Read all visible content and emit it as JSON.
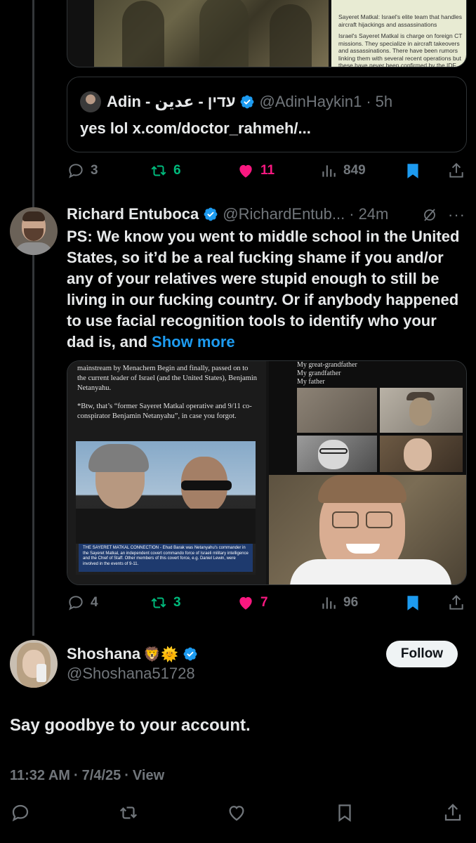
{
  "quoted_tweet_top": {
    "doc_heading": "Sayeret Matkal: Israel's elite team that handles aircraft hijackings and assassinations",
    "doc_body": "Israel's Sayeret Matkal is charge on foreign CT missions. They specialize in aircraft takeovers and assassinations. There have been rumors linking them with several recent operations but these have never been confirmed by the IDF."
  },
  "quote_card": {
    "name": "Adin - עדין - عدين",
    "handle": "@AdinHaykin1",
    "time": "5h",
    "sep": "·",
    "text": "yes lol x.com/doctor_rahmeh/..."
  },
  "actions_1": {
    "replies": "3",
    "reposts": "6",
    "likes": "11",
    "views": "849"
  },
  "reply_tweet": {
    "name": "Richard Entuboca",
    "handle": "@RichardEntub...",
    "sep": "·",
    "time": "24m",
    "text": "PS: We know you went to middle school in the United States, so it’d be a real fucking shame if you and/or any of your relatives were stupid enough to still be living in our fucking country. Or if anybody happened to use facial recognition tools to identify who your dad is, and",
    "show_more": "Show more",
    "img_left_text1": "mainstream by Menachem Begin and finally, passed on to the current leader of Israel (and the United States), Benjamin Netanyahu.",
    "img_left_text2": "*Btw, that’s “former Sayeret Matkal operative and 9/11 co-conspirator Benjamin Netanyahu”, in case you forgot.",
    "img_left_caption": "THE SAYERET MATKAL CONNECTION - Ehud Barak was Netanyahu's commander in the Sayeret Matkal, an independent covert commando force of Israeli military intelligence and the Chief of Staff. Other members of this covert force, e.g. Daniel Lewin, were involved in the events of 9-11.",
    "img_right_lines": [
      "My great-grandfather",
      "My grandfather",
      "My father"
    ]
  },
  "actions_2": {
    "replies": "4",
    "reposts": "3",
    "likes": "7",
    "views": "96"
  },
  "main_tweet": {
    "name": "Shoshana",
    "emojis": "🦁🌞",
    "handle": "@Shoshana51728",
    "follow_label": "Follow",
    "text": "Say goodbye to your account.",
    "time": "11:32 AM",
    "date": "7/4/25",
    "view_label": "View",
    "sep": "·"
  },
  "colors": {
    "blue": "#1d9bf0",
    "pink": "#f91880",
    "green": "#00ba7c",
    "gray": "#71767b"
  }
}
